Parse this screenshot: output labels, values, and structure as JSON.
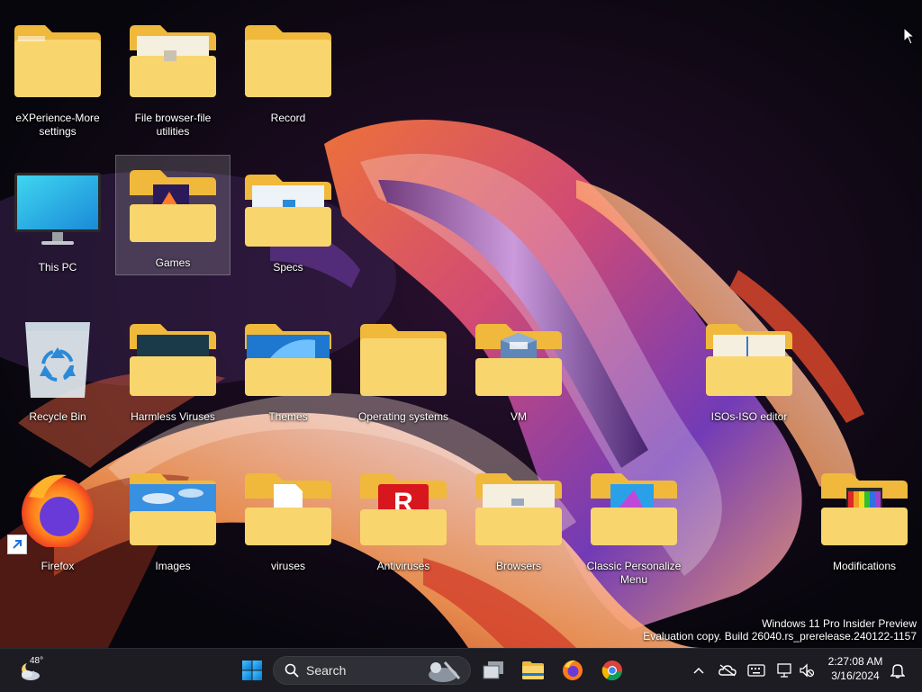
{
  "desktop": {
    "icons": [
      {
        "id": "experience",
        "label": "eXPerience-More settings"
      },
      {
        "id": "file-browser",
        "label": "File browser-file utilities"
      },
      {
        "id": "record",
        "label": "Record"
      },
      {
        "id": "this-pc",
        "label": "This PC"
      },
      {
        "id": "games",
        "label": "Games",
        "selected": true
      },
      {
        "id": "specs",
        "label": "Specs"
      },
      {
        "id": "recycle-bin",
        "label": "Recycle Bin"
      },
      {
        "id": "harmless-viruses",
        "label": "Harmless Viruses"
      },
      {
        "id": "themes",
        "label": "Themes"
      },
      {
        "id": "operating-systems",
        "label": "Operating systems"
      },
      {
        "id": "vm",
        "label": "VM"
      },
      {
        "id": "isos",
        "label": "ISOs-ISO editor"
      },
      {
        "id": "firefox",
        "label": "Firefox"
      },
      {
        "id": "images",
        "label": "Images"
      },
      {
        "id": "viruses",
        "label": "viruses"
      },
      {
        "id": "antiviruses",
        "label": "Antiviruses"
      },
      {
        "id": "browsers",
        "label": "Browsers"
      },
      {
        "id": "classic-personalize",
        "label": "Classic Personalize Menu"
      },
      {
        "id": "modifications",
        "label": "Modifications"
      }
    ]
  },
  "watermark": {
    "line1": "Windows 11 Pro Insider Preview",
    "line2": "Evaluation copy. Build 26040.rs_prerelease.240122-1157"
  },
  "taskbar": {
    "weather": {
      "temp": "48°",
      "icon": "weather-cloudy-moon-icon"
    },
    "search": {
      "placeholder": "Search"
    },
    "pinned": [
      "start-icon",
      "task-view-icon",
      "file-explorer-icon",
      "firefox-icon",
      "chrome-icon"
    ],
    "tray": [
      "chevron-up-icon",
      "onedrive-offline-icon",
      "keyboard-icon",
      "network-icon",
      "volume-muted-icon",
      "notification-bell-icon"
    ],
    "clock": {
      "time": "2:27:08 AM",
      "date": "3/16/2024"
    }
  },
  "colors": {
    "folder_front": "#f9d56e",
    "folder_back": "#f0b93c",
    "taskbar_bg": "#1c1c22",
    "accent_blue": "#0078d4"
  }
}
